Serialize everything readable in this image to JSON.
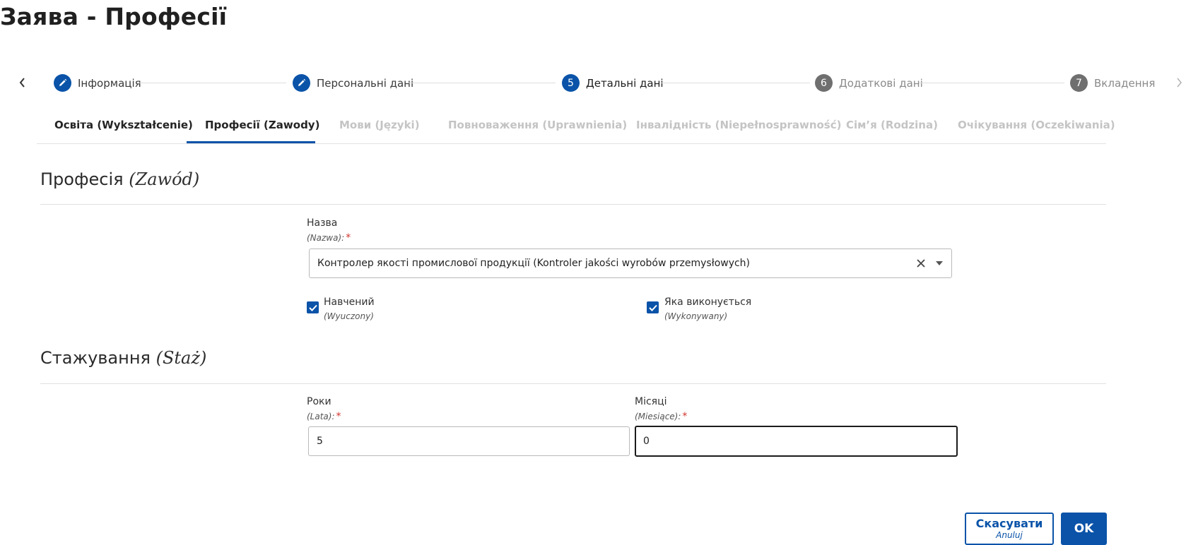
{
  "page": {
    "title": "Заява - Професії"
  },
  "stepper": {
    "steps": [
      {
        "number": "",
        "label": "Інформація",
        "state": "done",
        "icon": "pencil-icon"
      },
      {
        "number": "",
        "label": "Персональні дані",
        "state": "done",
        "icon": "pencil-icon"
      },
      {
        "number": "5",
        "label": "Детальні дані",
        "state": "active"
      },
      {
        "number": "6",
        "label": "Додаткові дані",
        "state": "upcoming"
      },
      {
        "number": "7",
        "label": "Вкладення",
        "state": "upcoming"
      }
    ],
    "prev_icon": "chevron-left-icon",
    "next_icon": "chevron-right-icon"
  },
  "tabs": [
    {
      "label": "Освіта (Wykształcenie)",
      "state": "normal"
    },
    {
      "label": "Професії (Zawody)",
      "state": "selected"
    },
    {
      "label": "Мови (Języki)",
      "state": "disabled"
    },
    {
      "label": "Повноваження (Uprawnienia)",
      "state": "disabled"
    },
    {
      "label": "Інвалідність (Niepełnosprawność)",
      "state": "disabled"
    },
    {
      "label": "Сім’я (Rodzina)",
      "state": "disabled"
    },
    {
      "label": "Очікування (Oczekiwania)",
      "state": "disabled"
    }
  ],
  "profession_section": {
    "title": "Професія",
    "title_alt": "(Zawód)",
    "name_field": {
      "label": "Назва",
      "sub_label": "(Nazwa):",
      "required_mark": "*",
      "value": "Контролер якості промислової продукції (Kontroler jakości wyrobów przemysłowych)"
    },
    "trained_checkbox": {
      "label": "Навчений",
      "sub_label": "(Wyuczony)",
      "checked": true
    },
    "performed_checkbox": {
      "label": "Яка виконується",
      "sub_label": "(Wykonywany)",
      "checked": true
    }
  },
  "experience_section": {
    "title": "Стажування",
    "title_alt": "(Staż)",
    "years_field": {
      "label": "Роки",
      "sub_label": "(Lata):",
      "required_mark": "*",
      "value": "5"
    },
    "months_field": {
      "label": "Місяці",
      "sub_label": "(Miesiące):",
      "required_mark": "*",
      "value": "0"
    }
  },
  "actions": {
    "cancel_label": "Скасувати",
    "cancel_sub": "Anuluj",
    "ok_label": "OK"
  },
  "colors": {
    "accent": "#0a53a8",
    "required": "#d0342c",
    "muted_step": "#6f6f6f",
    "disabled_tab": "#c4c4c4"
  }
}
